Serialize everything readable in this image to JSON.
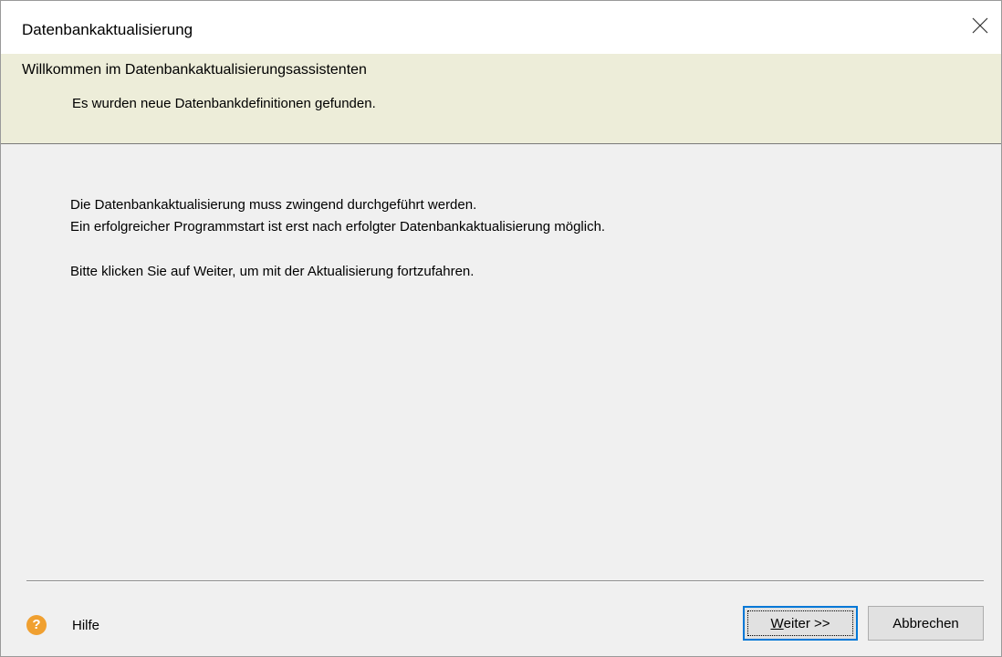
{
  "window": {
    "title": "Datenbankaktualisierung"
  },
  "header": {
    "title": "Willkommen im Datenbankaktualisierungsassistenten",
    "subtitle": "Es wurden neue Datenbankdefinitionen gefunden."
  },
  "content": {
    "lines": [
      "Die Datenbankaktualisierung muss zwingend durchgeführt werden.",
      "Ein erfolgreicher Programmstart ist erst nach erfolgter Datenbankaktualisierung möglich.",
      "Bitte klicken Sie auf Weiter, um mit der Aktualisierung fortzufahren."
    ]
  },
  "footer": {
    "help_label": "Hilfe",
    "help_icon_glyph": "?",
    "next_button": {
      "mnemonic": "W",
      "rest": "eiter >>"
    },
    "cancel_button": "Abbrechen"
  },
  "colors": {
    "header_band": "#ededd9",
    "focus_border": "#0078d7",
    "help_icon": "#f0a030"
  },
  "icons": {
    "close": "close-icon",
    "help": "help-icon"
  }
}
